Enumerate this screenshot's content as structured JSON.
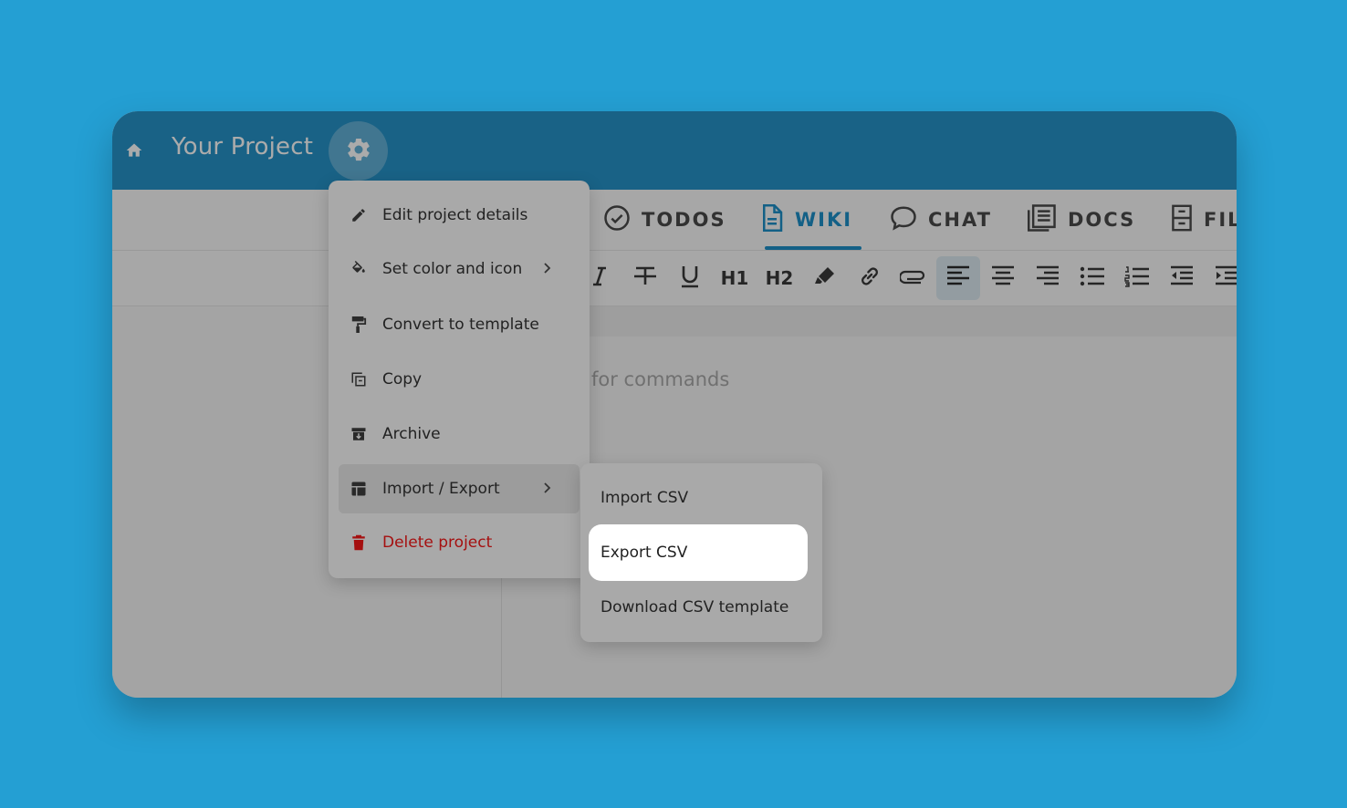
{
  "header": {
    "title": "Your Project"
  },
  "tabs": [
    {
      "label": "TODOS",
      "icon": "check-circle-icon"
    },
    {
      "label": "WIKI",
      "icon": "document-icon",
      "active": true
    },
    {
      "label": "CHAT",
      "icon": "chat-bubble-icon"
    },
    {
      "label": "DOCS",
      "icon": "docs-icon"
    },
    {
      "label": "FIL",
      "icon": "file-cabinet-icon"
    }
  ],
  "toolbar": {
    "h1_label": "H1",
    "h2_label": "H2"
  },
  "editor": {
    "placeholder": "for commands"
  },
  "menu": {
    "items": [
      {
        "label": "Edit project details",
        "icon": "pencil-icon"
      },
      {
        "label": "Set color and icon",
        "icon": "paint-bucket-icon",
        "submenu": true
      },
      {
        "label": "Convert to template",
        "icon": "paint-roller-icon"
      },
      {
        "label": "Copy",
        "icon": "copy-icon"
      },
      {
        "label": "Archive",
        "icon": "archive-icon"
      },
      {
        "label": "Import / Export",
        "icon": "table-icon",
        "submenu": true,
        "hover": true
      },
      {
        "label": "Delete project",
        "icon": "trash-icon",
        "danger": true
      }
    ]
  },
  "submenu": {
    "items": [
      {
        "label": "Import CSV"
      },
      {
        "label": "Export CSV",
        "selected": true
      },
      {
        "label": "Download CSV template"
      }
    ]
  },
  "colors": {
    "background": "#249fd3",
    "header": "#2693c8",
    "accent": "#1d8fc8",
    "danger": "#a51010"
  }
}
